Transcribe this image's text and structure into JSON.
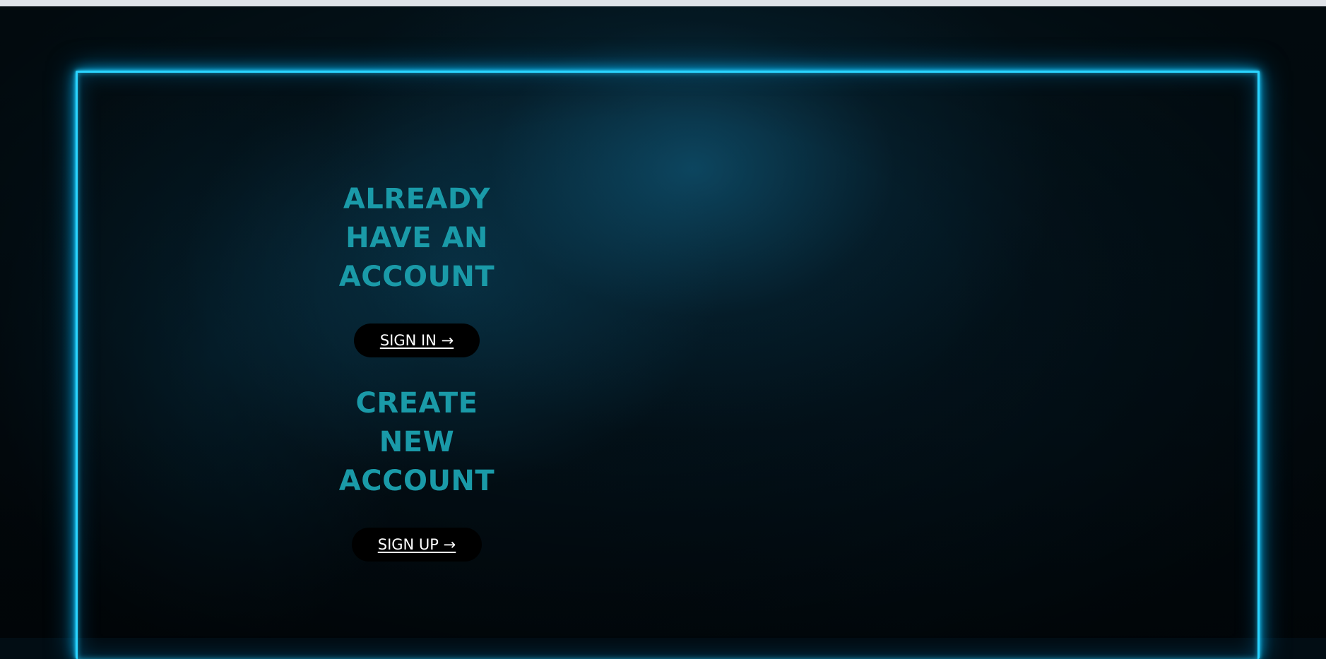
{
  "auth_panel": {
    "signin_heading": "ALREADY\nHAVE AN\nACCOUNT",
    "signin_button": "SIGN IN →",
    "signup_heading": "CREATE\nNEW\nACCOUNT",
    "signup_button": "SIGN UP →"
  },
  "colors": {
    "neon_frame": "#2ad4ff",
    "heading_text": "#1a9aa8",
    "button_bg": "#000000",
    "button_text": "#ffffff",
    "background": "#031119"
  }
}
